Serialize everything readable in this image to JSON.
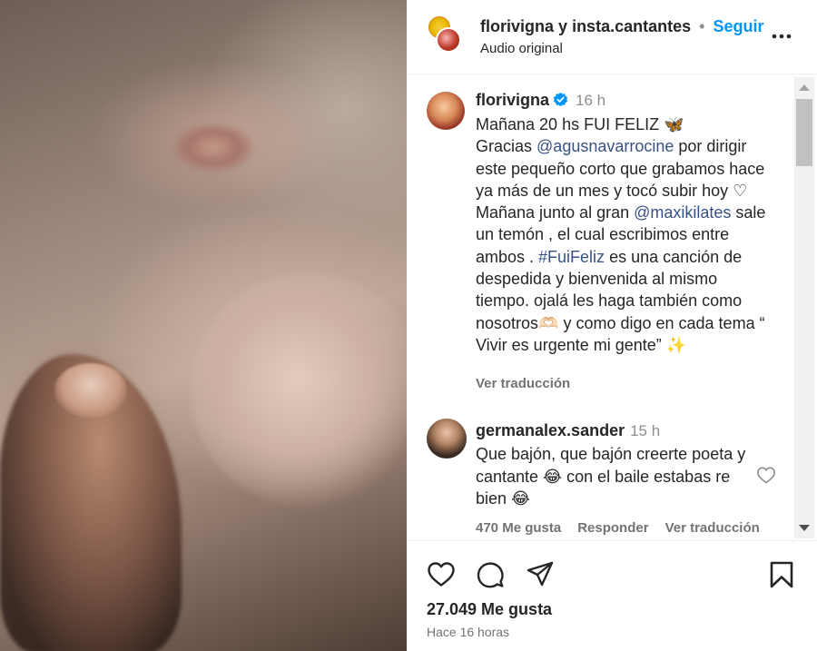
{
  "header": {
    "author": "florivigna",
    "connector": "y",
    "coauthor": "insta.cantantes",
    "separator": "•",
    "follow_label": "Seguir",
    "audio_label": "Audio original"
  },
  "caption": {
    "username": "florivigna",
    "time": "16 h",
    "line1": "Mañana 20 hs FUI FELIZ 🦋",
    "line2_pre": "Gracias ",
    "mention1": "@agusnavarrocine",
    "line2_post": " por dirigir este pequeño corto que grabamos hace ya más de un mes y tocó subir hoy ♡",
    "line3_pre": "Mañana junto al gran ",
    "mention2": "@maxikilates",
    "line3_post": " sale un temón , el cual escribimos entre ambos . ",
    "hashtag": "#FuiFeliz",
    "line4": " es una canción de despedida y bienvenida al mismo tiempo. ojalá les haga también como nosotros🫶🏻 y como digo en cada tema “ Vivir es urgente mi gente” ✨",
    "translate_label": "Ver traducción"
  },
  "comment": {
    "username": "germanalex.sander",
    "time": "15 h",
    "text": "Que bajón, que bajón creerte poeta y cantante 😂 con el baile estabas re bien 😂",
    "likes_label": "470 Me gusta",
    "reply_label": "Responder",
    "translate_label": "Ver traducción"
  },
  "footer": {
    "likes": "27.049 Me gusta",
    "posted": "Hace 16 horas"
  },
  "icons": {
    "like": "heart-icon",
    "comment": "comment-icon",
    "share": "share-icon",
    "save": "bookmark-icon",
    "more": "more-icon",
    "verified": "verified-icon"
  },
  "colors": {
    "link": "#385185",
    "follow": "#0095f6",
    "verified": "#0095f6",
    "muted": "#737373"
  }
}
